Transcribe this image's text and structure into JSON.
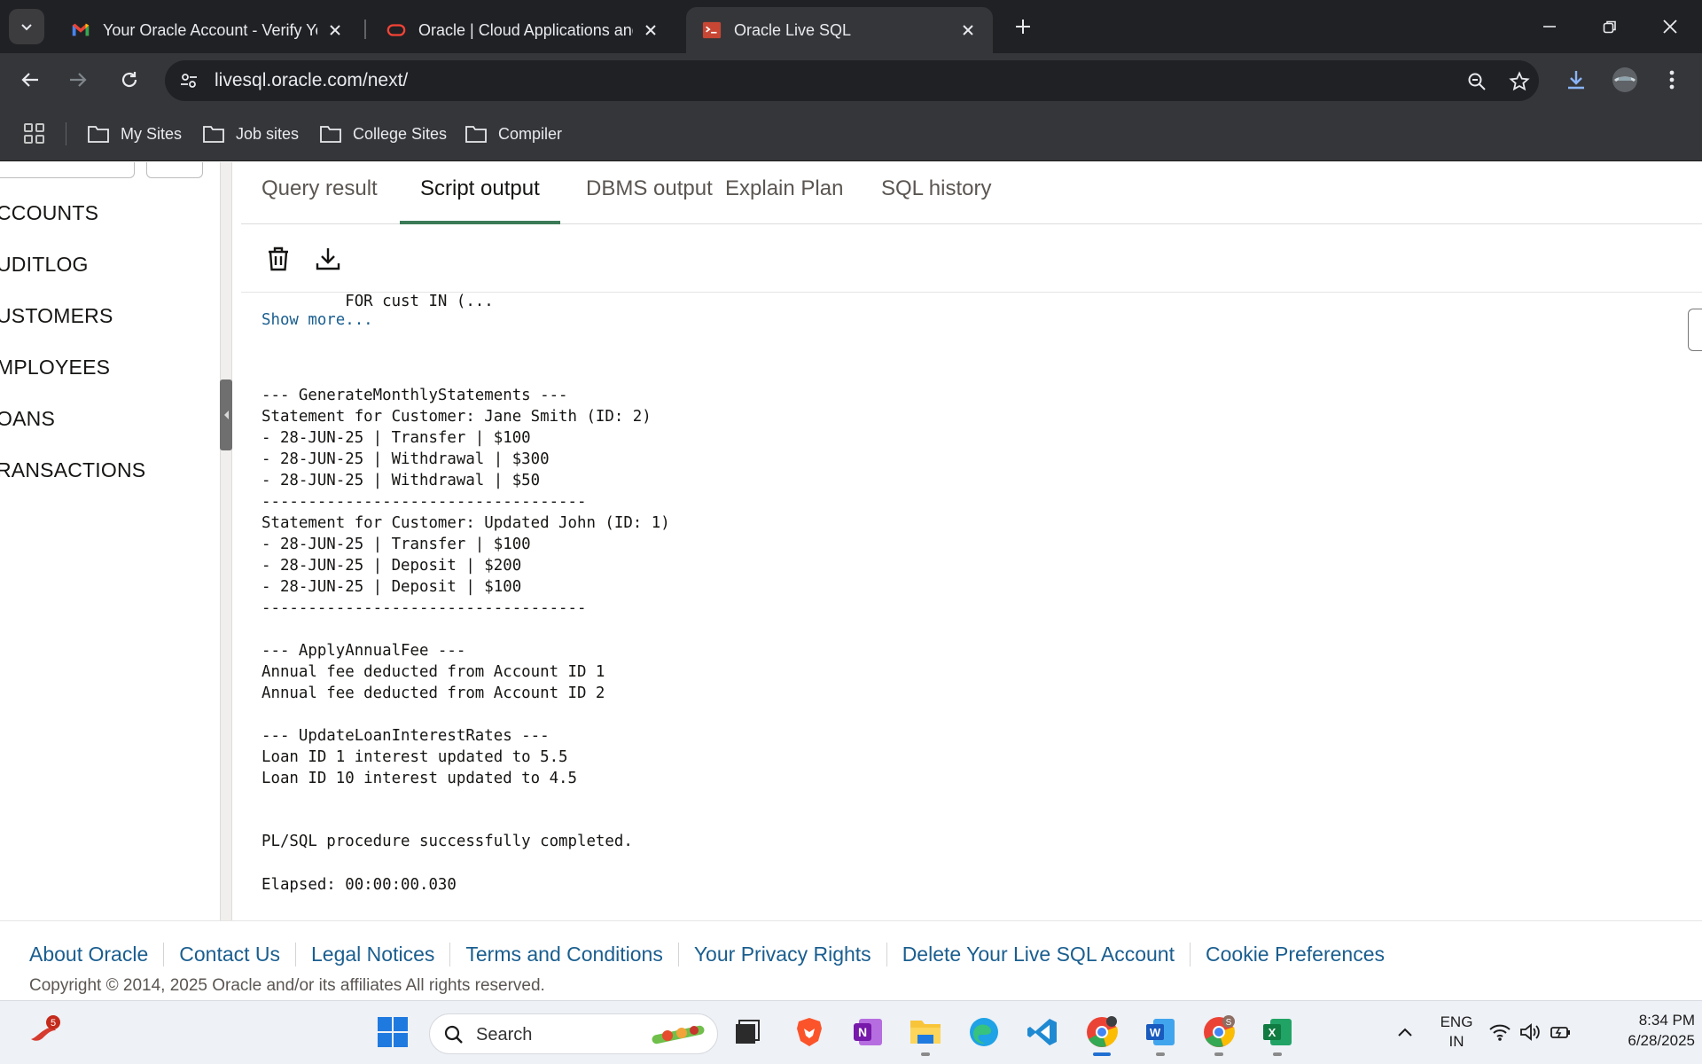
{
  "browser": {
    "tabs": [
      {
        "title": "Your Oracle Account - Verify Yo",
        "active": false
      },
      {
        "title": "Oracle | Cloud Applications and",
        "active": false
      },
      {
        "title": "Oracle Live SQL",
        "active": true
      }
    ],
    "url": "livesql.oracle.com/next/",
    "bookmarks": [
      "My Sites",
      "Job sites",
      "College Sites",
      "Compiler"
    ]
  },
  "schema_panel": {
    "tables": [
      "CCOUNTS",
      "UDITLOG",
      "USTOMERS",
      "MPLOYEES",
      "OANS",
      "RANSACTIONS"
    ]
  },
  "output_panel": {
    "tabs": [
      "Query result",
      "Script output",
      "DBMS output",
      "Explain Plan",
      "SQL history"
    ],
    "active_tab": "Script output",
    "console": {
      "truncated_line": "         FOR cust IN (...",
      "show_more": "Show more...",
      "lines": [
        "--- GenerateMonthlyStatements ---",
        "Statement for Customer: Jane Smith (ID: 2)",
        "- 28-JUN-25 | Transfer | $100",
        "- 28-JUN-25 | Withdrawal | $300",
        "- 28-JUN-25 | Withdrawal | $50",
        "-----------------------------------",
        "Statement for Customer: Updated John (ID: 1)",
        "- 28-JUN-25 | Transfer | $100",
        "- 28-JUN-25 | Deposit | $200",
        "- 28-JUN-25 | Deposit | $100",
        "-----------------------------------",
        "--- ApplyAnnualFee ---",
        "Annual fee deducted from Account ID 1",
        "Annual fee deducted from Account ID 2",
        "--- UpdateLoanInterestRates ---",
        "Loan ID 1 interest updated to 5.5",
        "Loan ID 10 interest updated to 4.5",
        "PL/SQL procedure successfully completed.",
        "Elapsed: 00:00:00.030"
      ]
    }
  },
  "footer": {
    "links": [
      "About Oracle",
      "Contact Us",
      "Legal Notices",
      "Terms and Conditions",
      "Your Privacy Rights",
      "Delete Your Live SQL Account",
      "Cookie Preferences"
    ],
    "copyright": "Copyright © 2014, 2025 Oracle and/or its affiliates All rights reserved."
  },
  "taskbar": {
    "notification_count": "5",
    "search_placeholder": "Search",
    "language": "ENG",
    "region": "IN",
    "time": "8:34 PM",
    "date": "6/28/2025",
    "chrome_profile_letter": "S"
  },
  "colors": {
    "accent_green": "#3b7a57",
    "link_blue": "#1a5e8f",
    "chrome_dark": "#202124"
  }
}
